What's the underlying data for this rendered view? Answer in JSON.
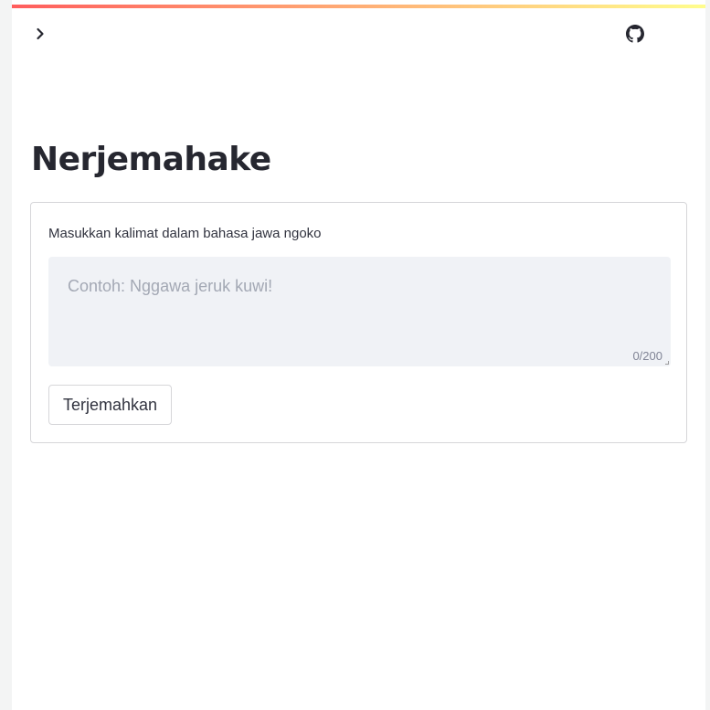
{
  "header": {
    "sidebar_toggle_icon": "chevron-right-icon",
    "repo_icon": "github-icon"
  },
  "main": {
    "title": "Nerjemahake",
    "form": {
      "input_label": "Masukkan kalimat dalam bahasa jawa ngoko",
      "input_placeholder": "Contoh: Nggawa jeruk kuwi!",
      "input_value": "",
      "char_count": "0/200",
      "submit_label": "Terjemahkan"
    }
  },
  "colors": {
    "gradient_start": "#ff4b4b",
    "gradient_end": "#fffd80",
    "text": "#31333f",
    "input_bg": "#f0f2f6"
  }
}
